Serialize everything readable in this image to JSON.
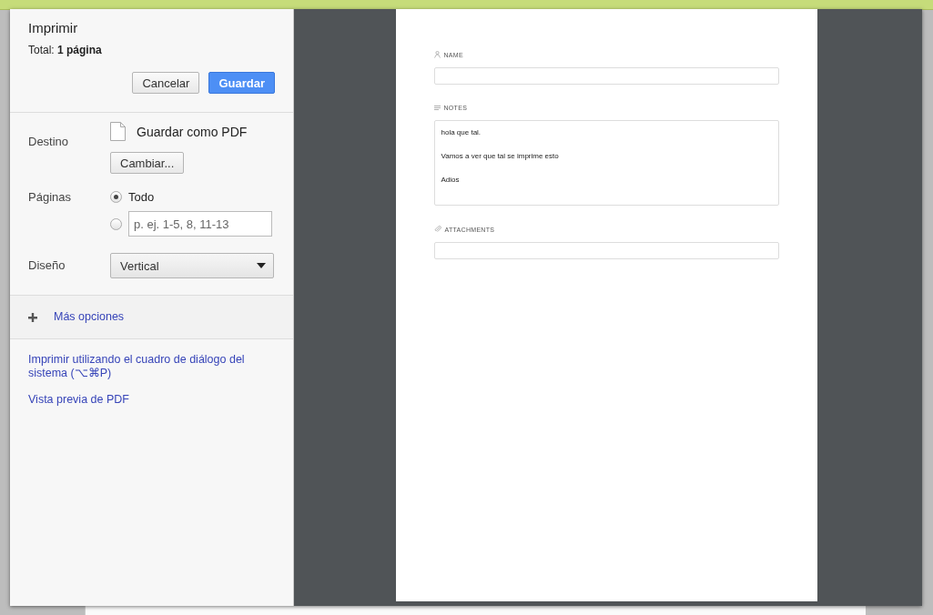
{
  "dialog": {
    "title": "Imprimir",
    "total_label": "Total:",
    "total_value": "1 página"
  },
  "buttons": [
    {
      "label": "Cancelar",
      "kind": "secondary"
    },
    {
      "label": "Guardar",
      "kind": "primary"
    }
  ],
  "destination": {
    "label": "Destino",
    "value": "Guardar como PDF",
    "change_button": "Cambiar..."
  },
  "pages": {
    "label": "Páginas",
    "options": [
      {
        "kind": "label",
        "text": "Todo",
        "selected": true
      },
      {
        "kind": "field",
        "placeholder": "p. ej. 1-5, 8, 11-13",
        "selected": false
      }
    ]
  },
  "layout": {
    "label": "Diseño",
    "value": "Vertical"
  },
  "more_options": {
    "label": "Más opciones",
    "expanded": false
  },
  "links": [
    "Imprimir utilizando el cuadro de diálogo del sistema (⌥⌘P)",
    "Vista previa de PDF"
  ],
  "preview": {
    "fields": [
      {
        "kind": "name",
        "label": "NAME"
      },
      {
        "kind": "notes",
        "label": "NOTES",
        "lines": [
          "hola que tal.",
          "Vamos a ver que tal se imprime esto",
          "Adios"
        ]
      },
      {
        "kind": "attachments",
        "label": "ATTACHMENTS"
      }
    ]
  }
}
